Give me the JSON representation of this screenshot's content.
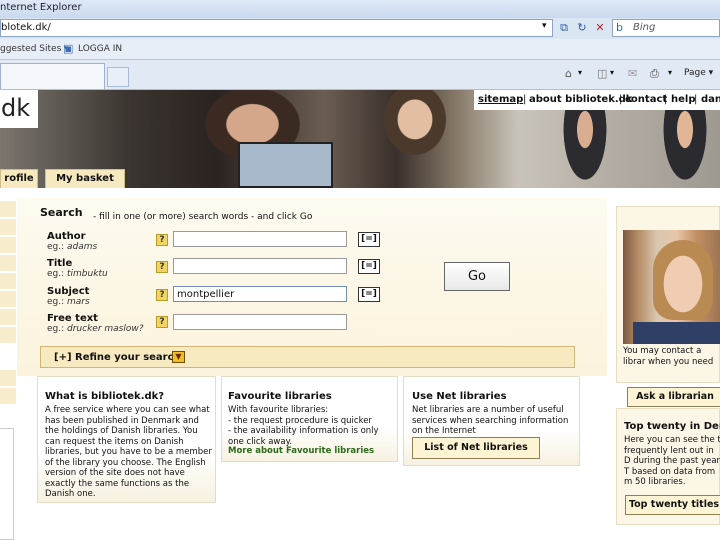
{
  "browser": {
    "title": "nternet Explorer",
    "address": "blotek.dk/",
    "search_placeholder": "Bing",
    "favorites": {
      "suggested": "ggested Sites ▾",
      "link": "LOGGA IN"
    },
    "command": {
      "page": "Page ▾"
    }
  },
  "site": {
    "logo": "dk",
    "top_links": [
      "sitemap",
      "about bibliotek.dk",
      "contact",
      "help",
      "dan"
    ],
    "nav_tabs": [
      "rofile",
      "My basket"
    ]
  },
  "search": {
    "heading": "Search",
    "hint": "- fill in one (or more) search words - and click Go",
    "fields": [
      {
        "label": "Author",
        "example_prefix": "eg.: ",
        "example": "adams",
        "value": "",
        "eq": "[=]"
      },
      {
        "label": "Title",
        "example_prefix": "eg.: ",
        "example": "timbuktu",
        "value": "",
        "eq": "[=]"
      },
      {
        "label": "Subject",
        "example_prefix": "eg.: ",
        "example": "mars",
        "value": "montpellier",
        "eq": "[=]"
      },
      {
        "label": "Free text",
        "example_prefix": "eg.: ",
        "example": "drucker maslow?",
        "value": "",
        "eq": ""
      }
    ],
    "help": "?",
    "go": "Go",
    "refine": "[+] Refine your search"
  },
  "boxes": [
    {
      "title": "What is bibliotek.dk?",
      "text": "A free service where you can see what has been published in Denmark and the holdings of Danish libraries. You can request the items on Danish libraries, but you have to be a member of the library you choose. The English version of the site does not have exactly the same functions as the Danish one."
    },
    {
      "title": "Favourite libraries",
      "text": "With favourite libraries:\n- the request procedure is quicker\n- the availability information is only one click away.",
      "link": "More about Favourite libraries"
    },
    {
      "title": "Use Net libraries",
      "text": "Net libraries are a number of useful services when searching information on the Internet",
      "button": "List of Net libraries"
    }
  ],
  "right": {
    "ask_text": "You may contact a librar when you need personal se",
    "ask_button": "Ask a librarian",
    "top_title": "Top twenty in Den",
    "top_text": "Here you can see the t frequently lent out in D during the past year. T based on data from m 50 libraries.",
    "top_button": "Top twenty titles"
  }
}
